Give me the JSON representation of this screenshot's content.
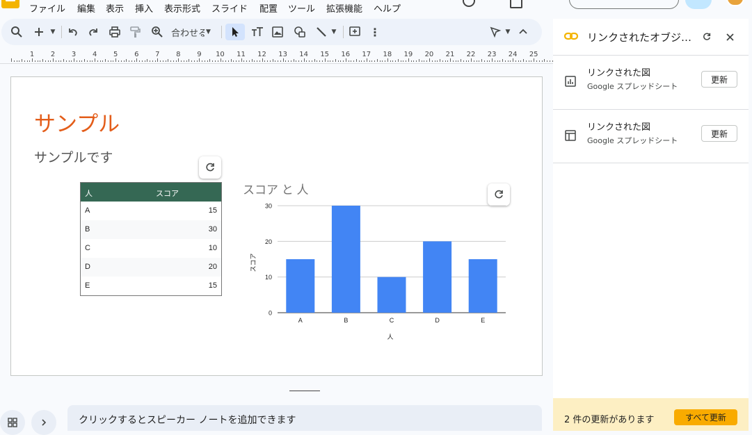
{
  "menu": [
    "ファイル",
    "編集",
    "表示",
    "挿入",
    "表示形式",
    "スライド",
    "配置",
    "ツール",
    "拡張機能",
    "ヘルプ"
  ],
  "toolbar": {
    "zoom_label": "合わせる",
    "icons": [
      "search-icon",
      "plus-icon",
      "undo-icon",
      "redo-icon",
      "print-icon",
      "paint-format-icon",
      "zoom-icon",
      "select-icon",
      "textbox-icon",
      "image-icon",
      "shape-icon",
      "line-icon",
      "comment-icon",
      "more-icon",
      "pointer-mode-icon",
      "collapse-icon"
    ]
  },
  "ruler": {
    "numbers": [
      "1",
      "2",
      "3",
      "4",
      "5",
      "6",
      "7",
      "8",
      "9",
      "10",
      "11",
      "12",
      "13",
      "14",
      "15",
      "16",
      "17",
      "18",
      "19",
      "20",
      "21",
      "22",
      "23",
      "24",
      "25"
    ]
  },
  "slide": {
    "title": "サンプル",
    "subtitle": "サンプルです",
    "title_color": "#e35d1a"
  },
  "table": {
    "header": [
      "人",
      "スコア"
    ],
    "header_color": "#356854",
    "rows": [
      [
        "A",
        "15"
      ],
      [
        "B",
        "30"
      ],
      [
        "C",
        "10"
      ],
      [
        "D",
        "20"
      ],
      [
        "E",
        "15"
      ]
    ]
  },
  "chart_data": {
    "type": "bar",
    "title": "スコア と 人",
    "categories": [
      "A",
      "B",
      "C",
      "D",
      "E"
    ],
    "values": [
      15,
      30,
      10,
      20,
      15
    ],
    "xlabel": "人",
    "ylabel": "スコア",
    "ylim": [
      0,
      30
    ],
    "yticks": [
      "0",
      "10",
      "20",
      "30"
    ],
    "grid": true,
    "bar_color": "#4285f4"
  },
  "notes": {
    "placeholder": "クリックするとスピーカー ノートを追加できます"
  },
  "panel": {
    "title": "リンクされたオブジ…",
    "accent": "#f4b400",
    "items": [
      {
        "name": "リンクされた図",
        "source": "Google スプレッドシート",
        "button": "更新",
        "icon": "chart-icon"
      },
      {
        "name": "リンクされた図",
        "source": "Google スプレッドシート",
        "button": "更新",
        "icon": "table-icon"
      }
    ],
    "footer_message": "2 件の更新があります",
    "footer_button": "すべて更新",
    "footer_color": "#fdefc3"
  }
}
